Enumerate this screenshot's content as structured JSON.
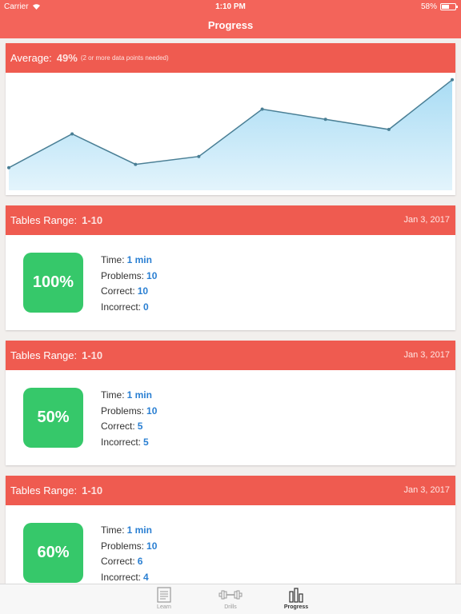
{
  "status_bar": {
    "carrier": "Carrier",
    "time": "1:10 PM",
    "battery": "58%",
    "battery_level": 0.58
  },
  "nav": {
    "title": "Progress"
  },
  "average": {
    "label": "Average:",
    "value": "49%",
    "note": "(2 or more data points needed)"
  },
  "chart_data": {
    "type": "area",
    "values": [
      20,
      50,
      23,
      30,
      72,
      63,
      54,
      98
    ],
    "ylim": [
      0,
      100
    ],
    "line_color": "#4a7f95",
    "fill_top": "#a9dcf4",
    "fill_bottom": "#e3f4fc"
  },
  "sessions": [
    {
      "range_label": "Tables Range:",
      "range_value": "1-10",
      "date": "Jan 3, 2017",
      "score": "100%",
      "time_label": "Time:",
      "time_value": "1 min",
      "problems_label": "Problems:",
      "problems_value": "10",
      "correct_label": "Correct:",
      "correct_value": "10",
      "incorrect_label": "Incorrect:",
      "incorrect_value": "0"
    },
    {
      "range_label": "Tables Range:",
      "range_value": "1-10",
      "date": "Jan 3, 2017",
      "score": "50%",
      "time_label": "Time:",
      "time_value": "1 min",
      "problems_label": "Problems:",
      "problems_value": "10",
      "correct_label": "Correct:",
      "correct_value": "5",
      "incorrect_label": "Incorrect:",
      "incorrect_value": "5"
    },
    {
      "range_label": "Tables Range:",
      "range_value": "1-10",
      "date": "Jan 3, 2017",
      "score": "60%",
      "time_label": "Time:",
      "time_value": "1 min",
      "problems_label": "Problems:",
      "problems_value": "10",
      "correct_label": "Correct:",
      "correct_value": "6",
      "incorrect_label": "Incorrect:",
      "incorrect_value": "4"
    }
  ],
  "tabs": [
    {
      "label": "Learn",
      "icon": "book-icon"
    },
    {
      "label": "Drills",
      "icon": "dumbbell-icon"
    },
    {
      "label": "Progress",
      "icon": "bar-chart-icon",
      "active": true
    }
  ],
  "colors": {
    "accent": "#f3645a",
    "card_header": "#ef5b50",
    "score_badge": "#36c86a",
    "stat_value": "#2a7fd2"
  }
}
